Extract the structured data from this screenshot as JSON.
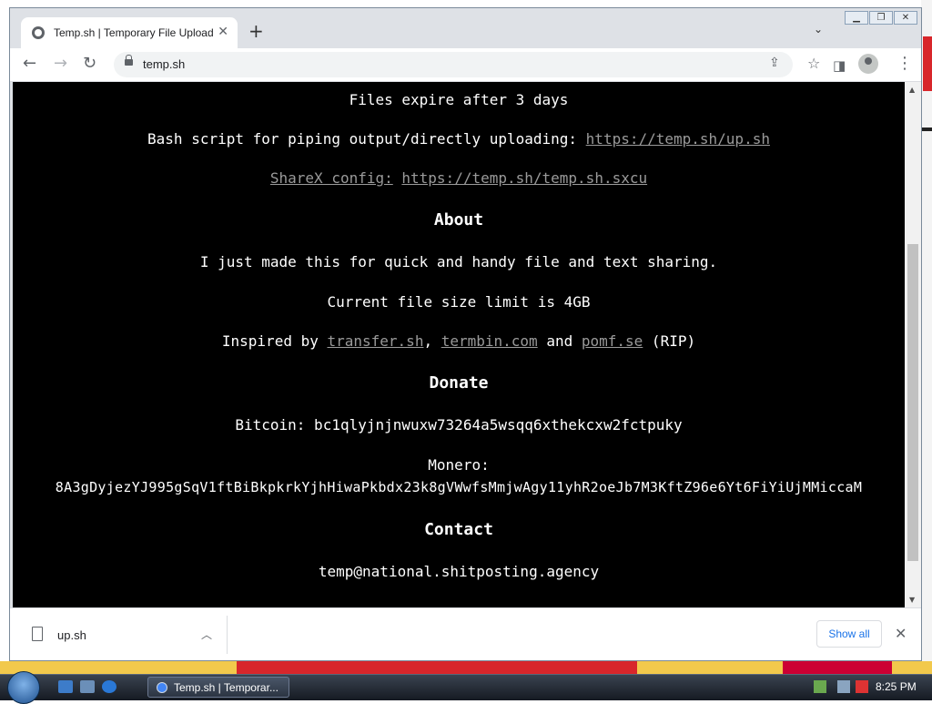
{
  "browser": {
    "tab_title": "Temp.sh | Temporary File Upload",
    "address": "temp.sh"
  },
  "page": {
    "expire_text": "Files expire after 3 days",
    "bash_text": "Bash script for piping output/directly uploading: ",
    "bash_link": "https://temp.sh/up.sh",
    "sharex_link": "ShareX config:",
    "sharex_url": "https://temp.sh/temp.sh.sxcu",
    "about_heading": "About",
    "about_text": "I just made this for quick and handy file and text sharing.",
    "size_limit": "Current file size limit is 4GB",
    "inspired_prefix": "Inspired by ",
    "inspired_links": [
      "transfer.sh",
      "termbin.com",
      "pomf.se"
    ],
    "inspired_sep": ", ",
    "inspired_and": " and ",
    "inspired_suffix": " (RIP)",
    "donate_heading": "Donate",
    "bitcoin": "Bitcoin: bc1qlyjnjnwuxw73264a5wsqq6xthekcxw2fctpuky",
    "monero_label": "Monero:",
    "monero_address": "8A3gDyjezYJ995gSqV1ftBiBkpkrkYjhHiwaPkbdx23k8gVWwfsMmjwAgy11yhR2oeJb7M3KftZ96e6Yt6FiYiUjMMiccaM",
    "contact_heading": "Contact",
    "contact_email": "temp@national.shitposting.agency"
  },
  "downloads": {
    "file_name": "up.sh",
    "show_all": "Show all"
  },
  "taskbar": {
    "task_label": "Temp.sh | Temporar...",
    "clock": "8:25 PM"
  },
  "icons": [
    "back-icon",
    "forward-icon",
    "reload-icon",
    "lock-icon",
    "share-icon",
    "star-icon",
    "side-panel-icon",
    "profile-icon",
    "menu-icon",
    "file-icon",
    "close-icon"
  ]
}
